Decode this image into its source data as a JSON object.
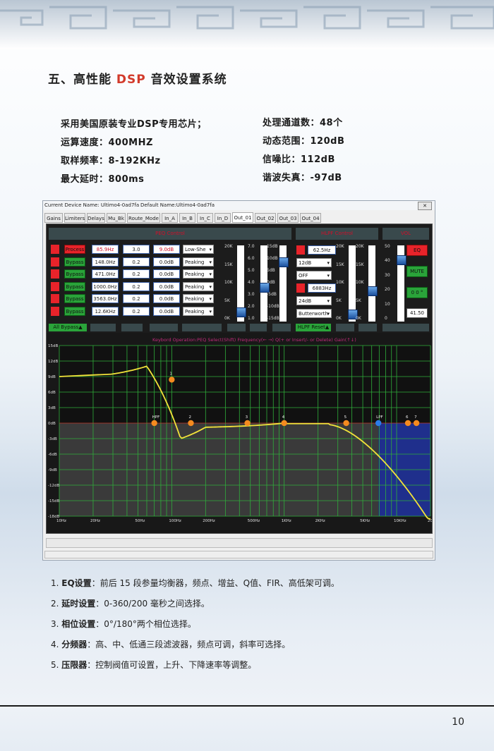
{
  "section": {
    "title_prefix": "五、高性能 ",
    "title_accent": "DSP",
    "title_suffix": " 音效设置系统"
  },
  "specs_left": [
    "采用美国原装专业DSP专用芯片；",
    "运算速度：400MHZ",
    "取样频率：8-192KHz",
    "最大延时：800ms"
  ],
  "specs_right": [
    "处理通道数：48个",
    "动态范围：120dB",
    "信噪比：112dB",
    "谐波失真：-97dB"
  ],
  "software": {
    "current_device": "Current Device Name: Ultimo4-0ad7fa",
    "default_name": "Default Name:Ultimo4-0ad7fa",
    "tabs": [
      "Gains",
      "Limiters",
      "Delays",
      "Mu_Bk",
      "Route_Mode",
      "In_A",
      "In_B",
      "In_C",
      "In_D",
      "Out_01",
      "Out_02",
      "Out_03",
      "Out_04"
    ],
    "active_tab": "Out_01",
    "peq_header": "PEQ Control",
    "hlpf_header": "HLPF Control",
    "vol_header": "VOL",
    "peq_rows": [
      {
        "state": "Process",
        "freq": "85.9Hz",
        "q": "3.0",
        "gain": "9.0dB",
        "type": "Low-She"
      },
      {
        "state": "Bypass",
        "freq": "148.0Hz",
        "q": "0.2",
        "gain": "0.0dB",
        "type": "Peaking"
      },
      {
        "state": "Bypass",
        "freq": "471.0Hz",
        "q": "0.2",
        "gain": "0.0dB",
        "type": "Peaking"
      },
      {
        "state": "Bypass",
        "freq": "1000.0Hz",
        "q": "0.2",
        "gain": "0.0dB",
        "type": "Peaking"
      },
      {
        "state": "Bypass",
        "freq": "3563.0Hz",
        "q": "0.2",
        "gain": "0.0dB",
        "type": "Peaking"
      },
      {
        "state": "Bypass",
        "freq": "12.6KHz",
        "q": "0.2",
        "gain": "0.0dB",
        "type": "Peaking"
      }
    ],
    "hlpf": {
      "hpf_freq": "62.5Hz",
      "hpf_slope": "12dB",
      "hpf_type": "OFF",
      "lpf_freq": "6883Hz",
      "lpf_slope": "24dB",
      "lpf_type": "Butterworth"
    },
    "vol": {
      "eq": "EQ",
      "mute": "MUTE",
      "phase": "0 0 °",
      "value": "41.50"
    },
    "bottom_buttons": [
      "All Bypass▲",
      "HLPF Reset▲"
    ],
    "fader_scale_freq": [
      "20K",
      "15K",
      "10K",
      "5K",
      "0K"
    ],
    "fader_scale_q": [
      "7.0",
      "6.0",
      "5.0",
      "4.0",
      "3.0",
      "2.0",
      "1.0"
    ],
    "fader_scale_db": [
      "15dB",
      "10dB",
      "5dB",
      "0dB",
      "-5dB",
      "-10dB",
      "-15dB"
    ],
    "vol_scale": [
      "50",
      "40",
      "30",
      "20",
      "10",
      "0"
    ],
    "graph_info": "Keybord Operation:PEQ Select(Shift)   Frequency(← →)   Q(+ or Insert/- or Delete)   Gain(↑↓)",
    "y_labels": [
      "15dB",
      "12dB",
      "9dB",
      "6dB",
      "3dB",
      "0dB",
      "-3dB",
      "-6dB",
      "-9dB",
      "-12dB",
      "-15dB",
      "-18dB"
    ],
    "x_labels": [
      "10Hz",
      "20Hz",
      "50Hz",
      "100Hz",
      "200Hz",
      "500Hz",
      "1KHz",
      "2KHz",
      "5KHz",
      "10KHz",
      "20KHz"
    ],
    "markers": [
      "1",
      "HPF",
      "2",
      "3",
      "4",
      "5",
      "LPF",
      "6",
      "7"
    ]
  },
  "features": [
    {
      "n": "1.",
      "title": "EQ设置",
      "desc": "：前后 15 段参量均衡器，频点、增益、Q值、FIR、高低架可调。"
    },
    {
      "n": "2.",
      "title": "延时设置",
      "desc": "：0-360/200 毫秒之间选择。"
    },
    {
      "n": "3.",
      "title": "相位设置",
      "desc": "：0°/180°两个相位选择。"
    },
    {
      "n": "4.",
      "title": "分频器",
      "desc": "：高、中、低通三段滤波器，频点可调，斜率可选择。"
    },
    {
      "n": "5.",
      "title": "压限器",
      "desc": "：控制阀值可设置，上升、下降速率等调整。"
    }
  ],
  "page_number": "10",
  "colors": {
    "accent": "#d23a2b",
    "header_teal": "#39494c",
    "bypass": "#2aa43a",
    "process": "#e8232a"
  }
}
